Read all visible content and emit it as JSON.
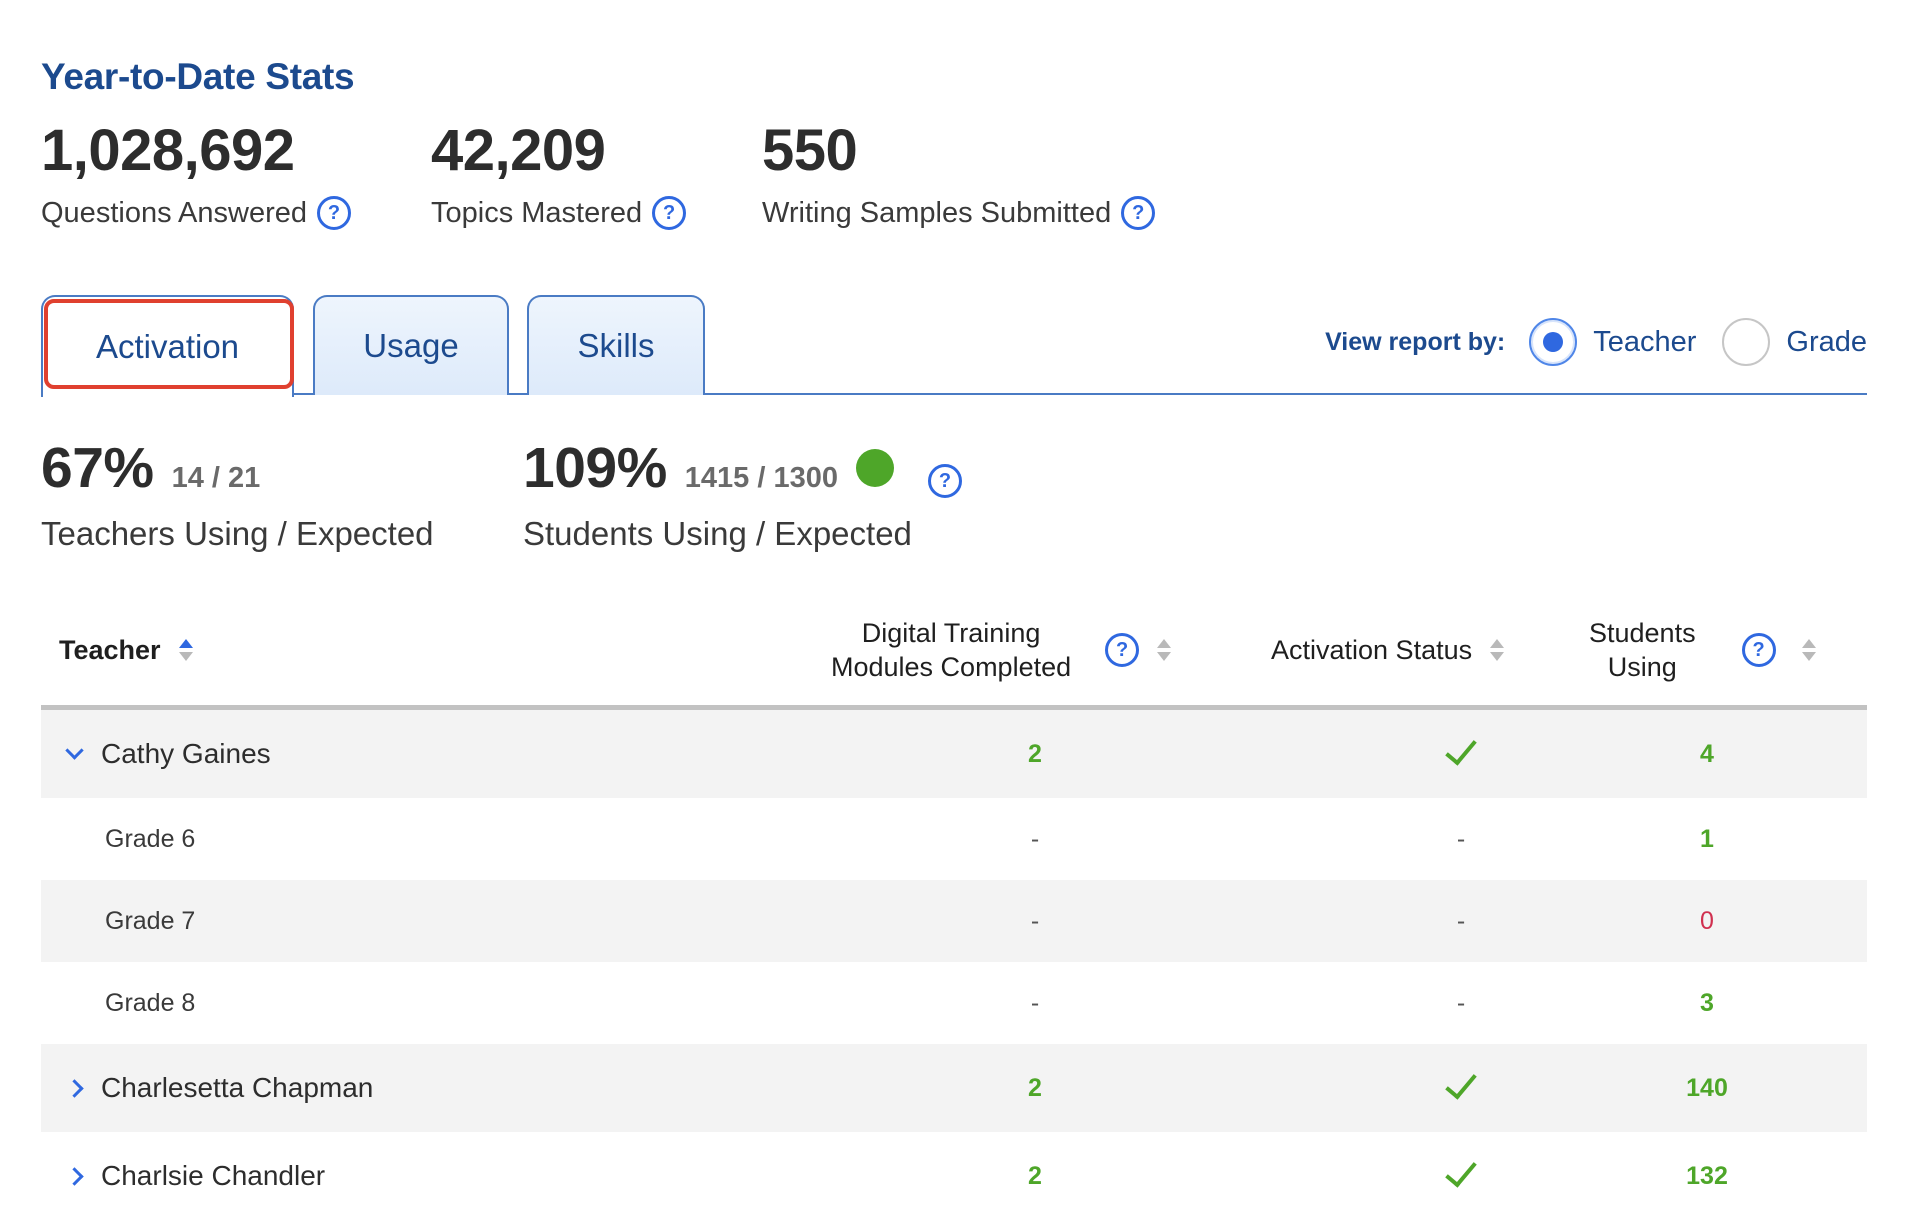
{
  "ytd": {
    "title": "Year-to-Date Stats",
    "stats": [
      {
        "value": "1,028,692",
        "label": "Questions Answered"
      },
      {
        "value": "42,209",
        "label": "Topics Mastered"
      },
      {
        "value": "550",
        "label": "Writing Samples Submitted"
      }
    ]
  },
  "tabs": [
    {
      "label": "Activation",
      "active": true
    },
    {
      "label": "Usage",
      "active": false
    },
    {
      "label": "Skills",
      "active": false
    }
  ],
  "view_report": {
    "label": "View report by:",
    "options": [
      {
        "label": "Teacher",
        "selected": true
      },
      {
        "label": "Grade",
        "selected": false
      }
    ]
  },
  "metrics": {
    "teachers": {
      "percent": "67%",
      "ratio": "14 / 21",
      "label": "Teachers Using / Expected"
    },
    "students": {
      "percent": "109%",
      "ratio": "1415 / 1300",
      "label": "Students Using / Expected",
      "status_color": "#4ea629"
    }
  },
  "table": {
    "headers": {
      "teacher": "Teacher",
      "modules_line1": "Digital Training",
      "modules_line2": "Modules Completed",
      "activation": "Activation Status",
      "students_line1": "Students",
      "students_line2": "Using"
    },
    "rows": [
      {
        "name": "Cathy Gaines",
        "modules": "2",
        "activated": true,
        "students": "4",
        "expanded": true
      },
      {
        "name": "Grade 6",
        "modules": "-",
        "activation": "-",
        "students": "1"
      },
      {
        "name": "Grade 7",
        "modules": "-",
        "activation": "-",
        "students": "0"
      },
      {
        "name": "Grade 8",
        "modules": "-",
        "activation": "-",
        "students": "3"
      },
      {
        "name": "Charlesetta Chapman",
        "modules": "2",
        "activated": true,
        "students": "140",
        "expanded": false
      },
      {
        "name": "Charlsie Chandler",
        "modules": "2",
        "activated": true,
        "students": "132",
        "expanded": false
      }
    ]
  },
  "help_glyph": "?",
  "colors": {
    "brand": "#1c4a8e",
    "accent": "#2f68e0",
    "success": "#4ea629",
    "danger": "#d0304f",
    "tab_highlight": "#e0402f"
  }
}
